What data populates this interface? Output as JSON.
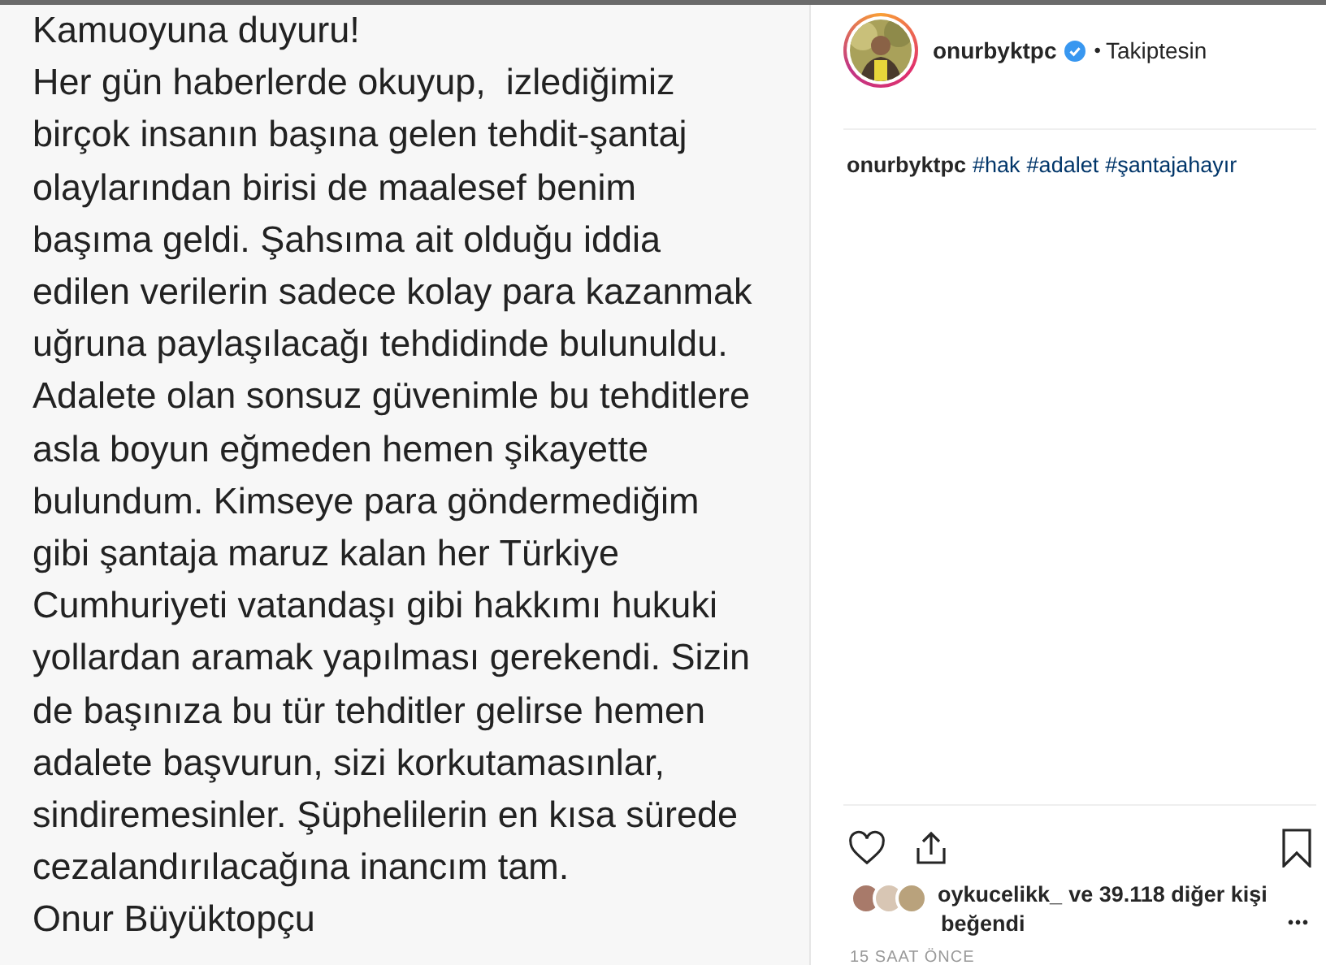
{
  "post_image_lines": [
    "Kamuoyuna duyuru!",
    "Her gün haberlerde okuyup,  izlediğimiz",
    "birçok insanın başına gelen tehdit-şantaj",
    "olaylarından birisi de maalesef benim",
    "başıma geldi. Şahsıma ait olduğu iddia",
    "edilen verilerin sadece kolay para kazanmak",
    "uğruna paylaşılacağı tehdidinde bulunuldu.",
    "Adalete olan sonsuz güvenimle bu tehditlere",
    "asla boyun eğmeden hemen şikayette",
    "bulundum. Kimseye para göndermediğim",
    "gibi şantaja maruz kalan her Türkiye",
    "Cumhuriyeti vatandaşı gibi hakkımı hukuki",
    "yollardan aramak yapılması gerekendi. Sizin",
    "de başınıza bu tür tehditler gelirse hemen",
    "adalete başvurun, sizi korkutamasınlar,",
    "sindiremesinler. Şüphelilerin en kısa sürede",
    "cezalandırılacağına inancım tam.",
    "Onur Büyüktopçu"
  ],
  "header": {
    "username": "onurbyktpc",
    "verified": true,
    "separator": "•",
    "follow_status": "Takiptesin"
  },
  "caption": {
    "username": "onurbyktpc",
    "hashtags": [
      "#hak",
      "#adalet",
      "#şantajahayır"
    ]
  },
  "actions": {
    "liked": false,
    "saved": false
  },
  "likes": {
    "user": "oykucelikk_",
    "rest": "ve 39.118 diğer kişi",
    "verb": "beğendi"
  },
  "more": "•••",
  "timestamp": "15 SAAT ÖNCE"
}
